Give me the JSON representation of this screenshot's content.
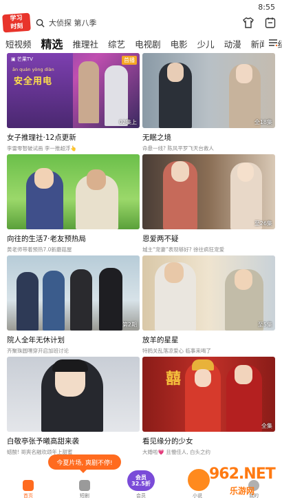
{
  "status": {
    "time": "8:55"
  },
  "header": {
    "logo_line1": "学习",
    "logo_line2": "时刻",
    "search_placeholder": "大侦探 第八季"
  },
  "tabs": [
    "短视频",
    "精选",
    "推理社",
    "综艺",
    "电视剧",
    "电影",
    "少儿",
    "动漫",
    "新闻",
    "纪"
  ],
  "cards": [
    {
      "title": "女子推理社·12点更新",
      "sub": "李雷零智破试画 李一推超浮👆",
      "ep": "02集上",
      "tag": "首播",
      "thumb": "card1",
      "thumb_text": "安全用电",
      "thumb_pinyin": "ān  quán yòng diàn"
    },
    {
      "title": "无眠之境",
      "sub": "命悬一线? 陈风平罗飞天台救人",
      "ep": "全18集",
      "thumb": "card2"
    },
    {
      "title": "向往的生活7·老友预热局",
      "sub": "黄老师带着预热7.0新蘑菇屋",
      "ep": "",
      "thumb": "card3"
    },
    {
      "title": "恩爱两不疑",
      "sub": "城主“宠妻”表现够好? 徐往疯狂宠爱",
      "ep": "至26集",
      "thumb": "card4"
    },
    {
      "title": "院人全年无休计划",
      "sub": "齐聚珠圆嘿穿开启加班讨论",
      "ep": "第2期",
      "thumb": "card5"
    },
    {
      "title": "放羊的星星",
      "sub": "特鸥关乱落凉爱心 临事来喝了",
      "ep": "至5集",
      "thumb": "card6"
    },
    {
      "title": "白敬亭张予曦高甜来袭",
      "sub": "蜡酸! 哥爽名融欢颂年上甜蜜",
      "ep": "",
      "thumb": "card7"
    },
    {
      "title": "看见缘分的少女",
      "sub": "大婚啦💗 且慢佳人, 白头之约",
      "ep": "全集",
      "thumb": "card8",
      "thumb_text": "囍"
    }
  ],
  "promo": "今夏片场, 爽剧不停!",
  "nav": [
    {
      "label": "首页",
      "icon": "home-icon"
    },
    {
      "label": "短剧",
      "icon": "short-drama-icon"
    },
    {
      "label": "会员",
      "icon": "vip-icon",
      "badge": "会员\n32.5折"
    },
    {
      "label": "小说",
      "icon": "book-icon"
    },
    {
      "label": "我的",
      "icon": "profile-icon"
    }
  ],
  "watermark": {
    "brand": "962.NET",
    "sub": "乐游网"
  },
  "colors": {
    "accent": "#ff6b1f",
    "logo": "#e8342b",
    "vip": "#7a4bd8"
  }
}
